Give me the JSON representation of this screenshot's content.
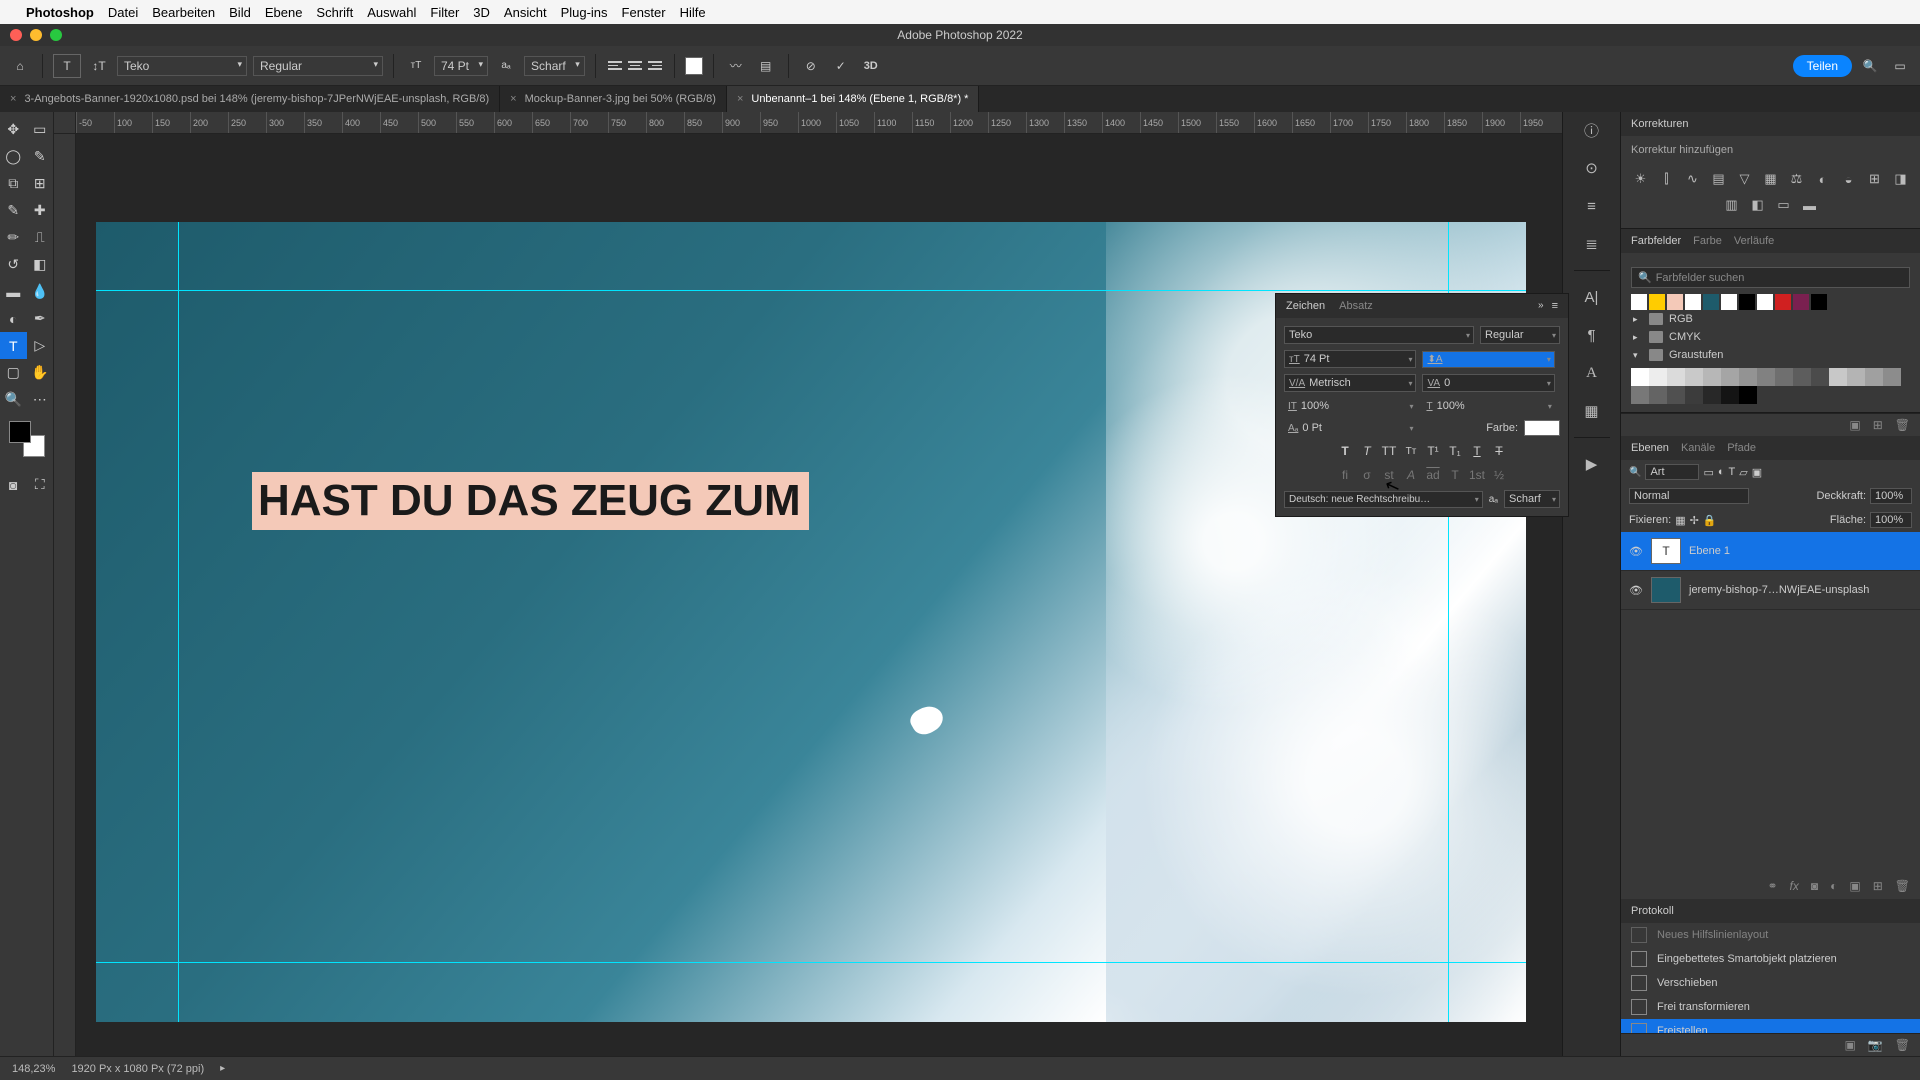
{
  "menubar": {
    "app": "Photoshop",
    "items": [
      "Datei",
      "Bearbeiten",
      "Bild",
      "Ebene",
      "Schrift",
      "Auswahl",
      "Filter",
      "3D",
      "Ansicht",
      "Plug-ins",
      "Fenster",
      "Hilfe"
    ]
  },
  "window_title": "Adobe Photoshop 2022",
  "options": {
    "font_family": "Teko",
    "font_weight": "Regular",
    "font_size": "74 Pt",
    "antialias": "Scharf",
    "share": "Teilen"
  },
  "tabs": [
    {
      "label": "3-Angebots-Banner-1920x1080.psd bei 148% (jeremy-bishop-7JPerNWjEAE-unsplash, RGB/8)",
      "active": false
    },
    {
      "label": "Mockup-Banner-3.jpg bei 50% (RGB/8)",
      "active": false
    },
    {
      "label": "Unbenannt–1 bei 148% (Ebene 1, RGB/8*) *",
      "active": true
    }
  ],
  "ruler_ticks": [
    "-50",
    "100",
    "150",
    "200",
    "250",
    "300",
    "350",
    "400",
    "450",
    "500",
    "550",
    "600",
    "650",
    "700",
    "750",
    "800",
    "850",
    "900",
    "950",
    "1000",
    "1050",
    "1100",
    "1150",
    "1200",
    "1250",
    "1300",
    "1350",
    "1400",
    "1450",
    "1500",
    "1550",
    "1600",
    "1650",
    "1700",
    "1750",
    "1800",
    "1850",
    "1900",
    "1950"
  ],
  "canvas_text": "HAST DU DAS ZEUG ZUM",
  "status": {
    "zoom": "148,23%",
    "dims": "1920 Px x 1080 Px (72 ppi)"
  },
  "adjustments": {
    "title": "Korrekturen",
    "subtitle": "Korrektur hinzufügen"
  },
  "swatches": {
    "tabs": [
      "Farbfelder",
      "Farbe",
      "Verläufe"
    ],
    "search_placeholder": "Farbfelder suchen",
    "row_colors": [
      "#ffffff",
      "#ffcc00",
      "#f4c9b8",
      "#ffffff",
      "#1e5b6b",
      "#ffffff",
      "#000000",
      "#ffffff",
      "#d02020",
      "#7a2050",
      "#000000"
    ],
    "groups": {
      "rgb": "RGB",
      "cmyk": "CMYK",
      "grays": "Graustufen"
    }
  },
  "layers": {
    "tabs": [
      "Ebenen",
      "Kanäle",
      "Pfade"
    ],
    "kind": "Art",
    "blend": "Normal",
    "opacity_label": "Deckkraft:",
    "opacity": "100%",
    "lock_label": "Fixieren:",
    "fill_label": "Fläche:",
    "fill": "100%",
    "items": [
      {
        "name": "Ebene 1",
        "type": "T",
        "selected": true
      },
      {
        "name": "jeremy-bishop-7…NWjEAE-unsplash",
        "type": "img",
        "selected": false
      }
    ]
  },
  "history": {
    "title": "Protokoll",
    "items": [
      {
        "label": "Neues Hilfslinienlayout",
        "selected": false,
        "dim": true
      },
      {
        "label": "Eingebettetes Smartobjekt platzieren",
        "selected": false
      },
      {
        "label": "Verschieben",
        "selected": false
      },
      {
        "label": "Frei transformieren",
        "selected": false
      },
      {
        "label": "Freistellen",
        "selected": true
      }
    ]
  },
  "character": {
    "tabs": [
      "Zeichen",
      "Absatz"
    ],
    "font": "Teko",
    "weight": "Regular",
    "size": "74 Pt",
    "leading": "",
    "kerning": "Metrisch",
    "tracking": "0",
    "vscale": "100%",
    "hscale": "100%",
    "baseline": "0 Pt",
    "color_label": "Farbe:",
    "lang": "Deutsch: neue Rechtschreibu…",
    "aa": "Scharf"
  }
}
